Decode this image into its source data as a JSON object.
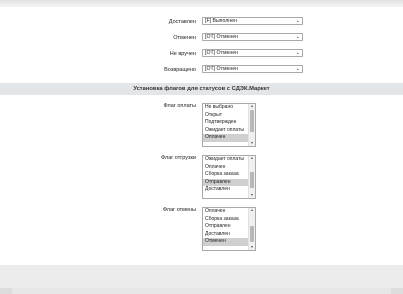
{
  "status_rows": [
    {
      "label": "Доставлен",
      "value": "[F] Выполнен"
    },
    {
      "label": "Отменен",
      "value": "[OT] Отменен"
    },
    {
      "label": "Не вручен",
      "value": "[OT] Отменен"
    },
    {
      "label": "Возвращено",
      "value": "[OT] Отменен"
    }
  ],
  "section": {
    "title": "Установка флагов для статусов с СДЭК.Маркет"
  },
  "flags": {
    "payment": {
      "label": "Флаг оплаты",
      "options": [
        "Не выбрано",
        "Открыт",
        "Подтвержден",
        "Ожидает оплаты",
        "Оплачен"
      ],
      "selected": [
        "Оплачен"
      ]
    },
    "shipment": {
      "label": "Флаг отгрузки",
      "options": [
        "Ожидает оплаты",
        "Оплачен",
        "Сборка заказа",
        "Отправлен",
        "Доставлен"
      ],
      "selected": [
        "Отправлен"
      ]
    },
    "cancel": {
      "label": "Флаг отмены",
      "options": [
        "Оплачен",
        "Сборка заказа",
        "Отправлен",
        "Доставлен",
        "Отменен"
      ],
      "selected": [
        "Отменен"
      ]
    }
  },
  "icons": {
    "dropdown": "chevron-down-icon",
    "scroll_up": "scroll-up-icon",
    "scroll_down": "scroll-down-icon"
  },
  "colors": {
    "section_bg": "#e3e6e8",
    "selected_option": "#cfcfcf",
    "page_bg": "#ececec"
  }
}
